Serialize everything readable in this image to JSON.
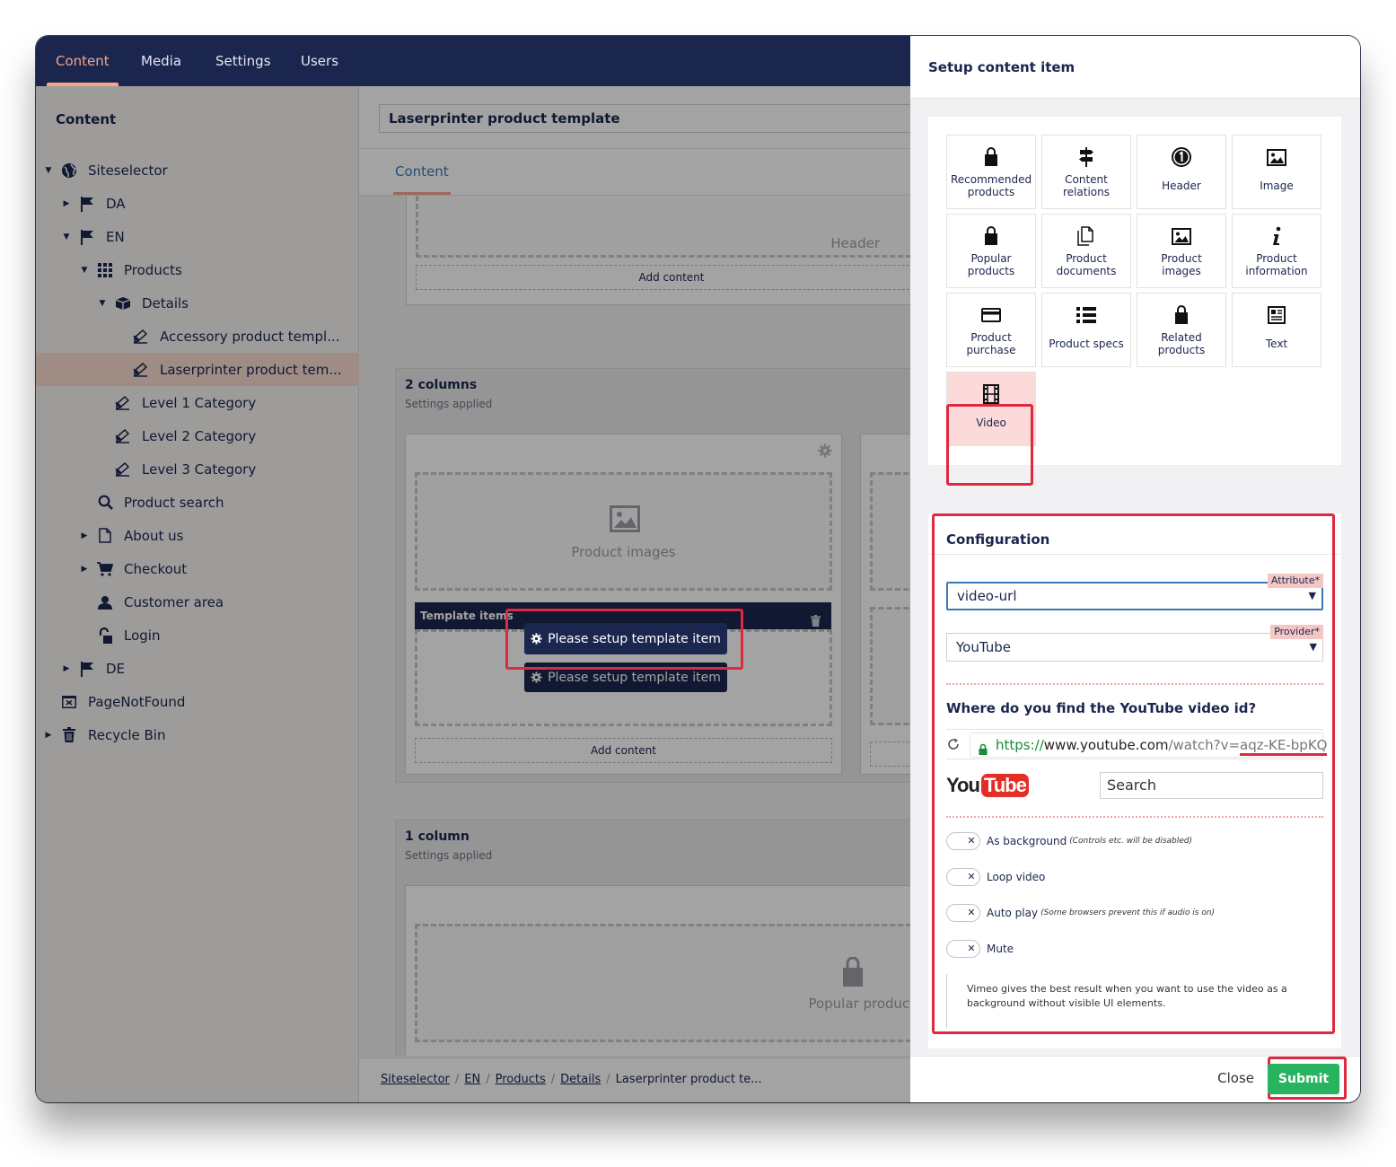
{
  "nav": {
    "tabs": [
      "Content",
      "Media",
      "Settings",
      "Users"
    ],
    "active": "Content"
  },
  "sidebar": {
    "heading": "Content",
    "items": [
      {
        "label": "Siteselector",
        "icon": "globe-icon",
        "caret": "down"
      },
      {
        "label": "DA",
        "icon": "flag-icon",
        "caret": "right"
      },
      {
        "label": "EN",
        "icon": "flag-icon",
        "caret": "down"
      },
      {
        "label": "Products",
        "icon": "grid-icon",
        "caret": "down"
      },
      {
        "label": "Details",
        "icon": "box-icon",
        "caret": "down"
      },
      {
        "label": "Accessory product templ...",
        "icon": "edit-icon",
        "caret": ""
      },
      {
        "label": "Laserprinter product tem...",
        "icon": "edit-icon",
        "caret": "",
        "selected": true
      },
      {
        "label": "Level 1 Category",
        "icon": "edit-icon",
        "caret": ""
      },
      {
        "label": "Level 2 Category",
        "icon": "edit-icon",
        "caret": ""
      },
      {
        "label": "Level 3 Category",
        "icon": "edit-icon",
        "caret": ""
      },
      {
        "label": "Product search",
        "icon": "search-icon",
        "caret": ""
      },
      {
        "label": "About us",
        "icon": "page-icon",
        "caret": "right"
      },
      {
        "label": "Checkout",
        "icon": "cart-icon",
        "caret": "right"
      },
      {
        "label": "Customer area",
        "icon": "user-icon",
        "caret": ""
      },
      {
        "label": "Login",
        "icon": "lock-icon",
        "caret": ""
      },
      {
        "label": "DE",
        "icon": "flag-icon",
        "caret": "right"
      },
      {
        "label": "PageNotFound",
        "icon": "notfound-icon",
        "caret": ""
      },
      {
        "label": "Recycle Bin",
        "icon": "trash-icon",
        "caret": "right"
      }
    ]
  },
  "main": {
    "page_title": "Laserprinter product template",
    "tab": "Content",
    "header_placeholder": "Header",
    "add_content": "Add content",
    "section_two": {
      "title": "2 columns",
      "subtitle": "Settings applied"
    },
    "product_images_placeholder": "Product images",
    "template_items": "Template items",
    "setup_button": "Please setup template item",
    "section_one": {
      "title": "1 column",
      "subtitle": "Settings applied"
    },
    "popular_products_placeholder": "Popular products"
  },
  "breadcrumb": {
    "items": [
      "Siteselector",
      "EN",
      "Products",
      "Details"
    ],
    "current": "Laserprinter product te..."
  },
  "panel": {
    "title": "Setup content item",
    "tiles": [
      {
        "label": "Recommended products",
        "icon": "bag-icon"
      },
      {
        "label": "Content relations",
        "icon": "signpost-icon"
      },
      {
        "label": "Header",
        "icon": "number-one-icon"
      },
      {
        "label": "Image",
        "icon": "image-icon"
      },
      {
        "label": "Popular products",
        "icon": "bag-icon"
      },
      {
        "label": "Product documents",
        "icon": "documents-icon"
      },
      {
        "label": "Product images",
        "icon": "image-icon"
      },
      {
        "label": "Product information",
        "icon": "info-icon"
      },
      {
        "label": "Product purchase",
        "icon": "credit-card-icon"
      },
      {
        "label": "Product specs",
        "icon": "list-icon"
      },
      {
        "label": "Related products",
        "icon": "bag-icon"
      },
      {
        "label": "Text",
        "icon": "newspaper-icon"
      },
      {
        "label": "Video",
        "icon": "film-icon",
        "selected": true
      }
    ],
    "config": {
      "title": "Configuration",
      "attribute": {
        "label": "Attribute*",
        "value": "video-url"
      },
      "provider": {
        "label": "Provider*",
        "value": "YouTube"
      },
      "question": "Where do you find the YouTube video id?",
      "url": {
        "scheme": "https://",
        "host": "www.youtube.com",
        "path": "/watch?v=",
        "video_id": "aqz-KE-bpKQ"
      },
      "youtube_logo": {
        "you": "You",
        "tube": "Tube"
      },
      "search_placeholder": "Search",
      "toggles": [
        {
          "label": "As background",
          "note": "(Controls etc. will be disabled)"
        },
        {
          "label": "Loop video",
          "note": ""
        },
        {
          "label": "Auto play",
          "note": "(Some browsers prevent this if audio is on)"
        },
        {
          "label": "Mute",
          "note": ""
        }
      ],
      "info": "Vimeo gives the best result when you want to use the video as a background without visible UI elements."
    },
    "close": "Close",
    "submit": "Submit"
  },
  "colors": {
    "navy": "#1b264f",
    "accent": "#f5a58a",
    "highlight": "#e0283e",
    "submit": "#27b360",
    "link": "#3a79b8"
  }
}
